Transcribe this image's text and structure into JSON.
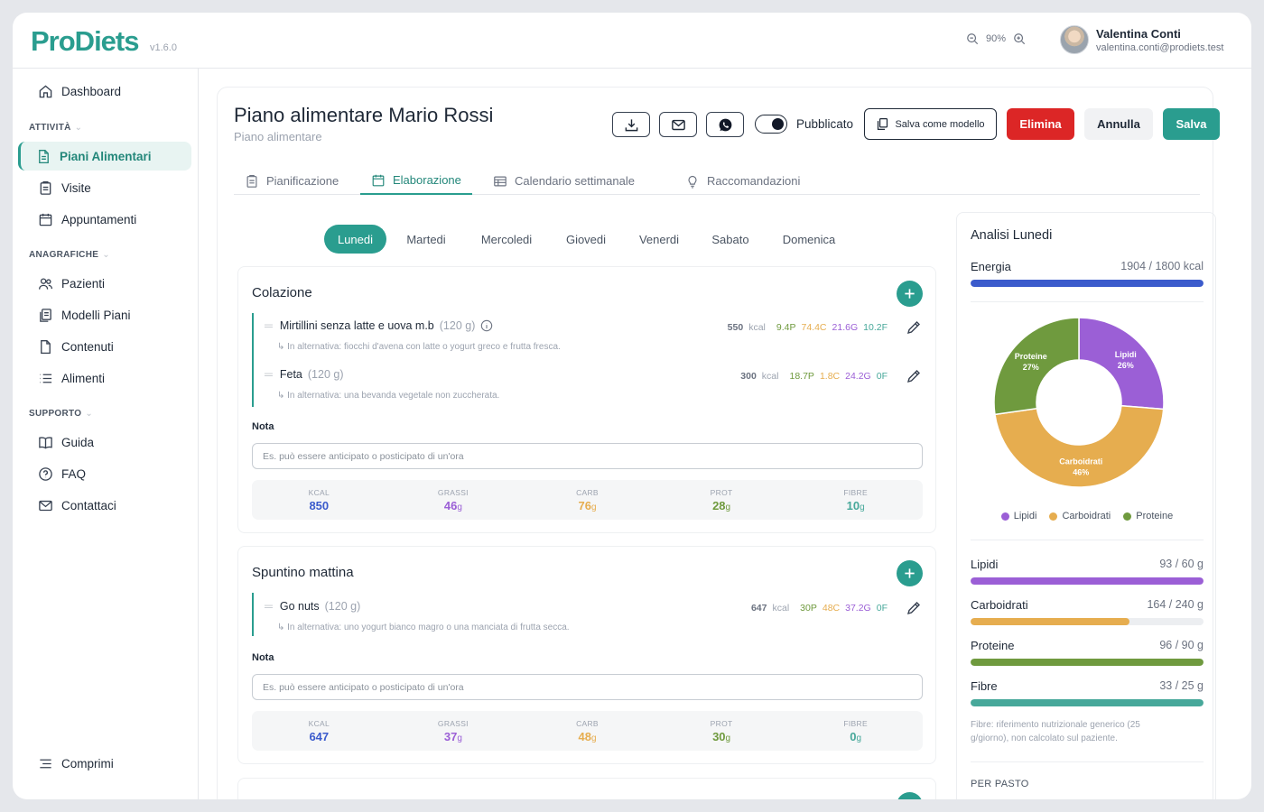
{
  "app": {
    "logo": "ProDiets",
    "version": "v1.6.0"
  },
  "header": {
    "zoom": "90%",
    "user": {
      "name": "Valentina Conti",
      "email": "valentina.conti@prodiets.test"
    }
  },
  "sidebar": {
    "dashboard": "Dashboard",
    "section_attivita": "ATTIVITÀ",
    "piani": "Piani Alimentari",
    "visite": "Visite",
    "appuntamenti": "Appuntamenti",
    "section_anagrafiche": "ANAGRAFICHE",
    "pazienti": "Pazienti",
    "modelli": "Modelli Piani",
    "contenuti": "Contenuti",
    "alimenti": "Alimenti",
    "section_supporto": "SUPPORTO",
    "guida": "Guida",
    "faq": "FAQ",
    "contattaci": "Contattaci",
    "comprimi": "Comprimi"
  },
  "page": {
    "title": "Piano alimentare Mario Rossi",
    "subtitle": "Piano alimentare",
    "published_label": "Pubblicato",
    "published": true,
    "save_template": "Salva come modello",
    "delete": "Elimina",
    "cancel": "Annulla",
    "save": "Salva"
  },
  "tabs": [
    "Pianificazione",
    "Elaborazione",
    "Calendario settimanale",
    "Raccomandazioni"
  ],
  "active_tab": "Elaborazione",
  "days": [
    "Lunedi",
    "Martedi",
    "Mercoledi",
    "Giovedi",
    "Venerdi",
    "Sabato",
    "Domenica"
  ],
  "active_day": "Lunedi",
  "meals": [
    {
      "title": "Colazione",
      "items": [
        {
          "name": "Mirtillini senza latte e uova m.b",
          "grams": "(120 g)",
          "alt": "↳ In alternativa: fiocchi d'avena con latte o yogurt greco e frutta fresca.",
          "kcal": "550",
          "kcal_unit": "kcal",
          "p": "9.4P",
          "c": "74.4C",
          "g": "21.6G",
          "f": "10.2F"
        },
        {
          "name": "Feta",
          "grams": "(120 g)",
          "alt": "↳ In alternativa: una bevanda vegetale non zuccherata.",
          "kcal": "300",
          "kcal_unit": "kcal",
          "p": "18.7P",
          "c": "1.8C",
          "g": "24.2G",
          "f": "0F"
        }
      ],
      "nota_label": "Nota",
      "nota_placeholder": "Es. può essere anticipato o posticipato di un'ora",
      "totals": {
        "kcal": "850",
        "grassi": "46",
        "carb": "76",
        "prot": "28",
        "fibre": "10"
      }
    },
    {
      "title": "Spuntino mattina",
      "items": [
        {
          "name": "Go nuts",
          "grams": "(120 g)",
          "alt": "↳ In alternativa: uno yogurt bianco magro o una manciata di frutta secca.",
          "kcal": "647",
          "kcal_unit": "kcal",
          "p": "30P",
          "c": "48C",
          "g": "37.2G",
          "f": "0F"
        }
      ],
      "nota_label": "Nota",
      "nota_placeholder": "Es. può essere anticipato o posticipato di un'ora",
      "totals": {
        "kcal": "647",
        "grassi": "37",
        "carb": "48",
        "prot": "30",
        "fibre": "0"
      }
    }
  ],
  "totals_labels": {
    "kcal": "KCAL",
    "grassi": "GRASSI",
    "carb": "CARB",
    "prot": "PROT",
    "fibre": "FIBRE",
    "unit": "g"
  },
  "analysis": {
    "title": "Analisi Lunedi",
    "energy": {
      "label": "Energia",
      "value": "1904 / 1800 kcal",
      "ratio": 1.0
    },
    "chart_data": {
      "type": "pie",
      "donut": true,
      "slices": [
        {
          "label": "Lipidi",
          "value": 26,
          "text": "26%",
          "color": "#9b5fd6"
        },
        {
          "label": "Carboidrati",
          "value": 46,
          "text": "46%",
          "color": "#e6ad4f"
        },
        {
          "label": "Proteine",
          "value": 27,
          "text": "27%",
          "color": "#6f9a3e"
        }
      ],
      "legend": [
        "Lipidi",
        "Carboidrati",
        "Proteine"
      ],
      "legend_position": "bottom"
    },
    "macros": [
      {
        "label": "Lipidi",
        "value": "93 / 60 g",
        "ratio": 1.0,
        "color": "#9b5fd6"
      },
      {
        "label": "Carboidrati",
        "value": "164 / 240 g",
        "ratio": 0.683,
        "color": "#e6ad4f"
      },
      {
        "label": "Proteine",
        "value": "96 / 90 g",
        "ratio": 1.0,
        "color": "#6f9a3e"
      },
      {
        "label": "Fibre",
        "value": "33 / 25 g",
        "ratio": 1.0,
        "color": "#47a89a"
      }
    ],
    "fibre_note": "Fibre: riferimento nutrizionale generico (25 g/giorno), non calcolato sul paziente.",
    "per_pasto": "PER PASTO"
  },
  "colors": {
    "accent": "#2a9d8f",
    "danger": "#dc2626",
    "energy": "#3b5bcc"
  }
}
